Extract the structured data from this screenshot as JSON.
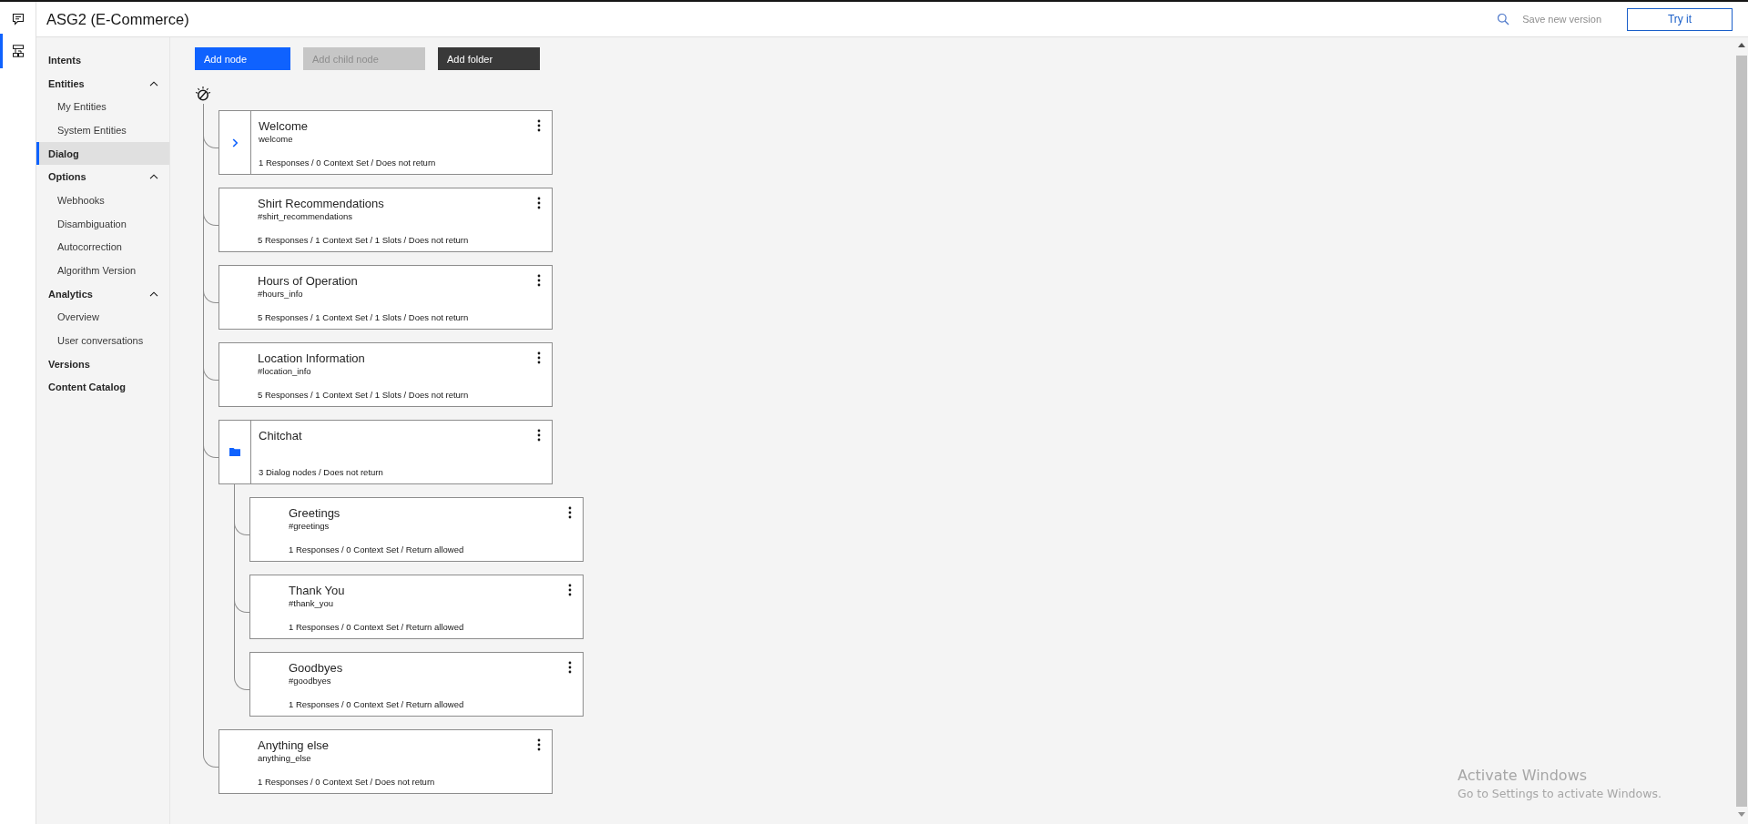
{
  "rail": {
    "items": [
      {
        "kind": "chat",
        "selected": false
      },
      {
        "kind": "tree",
        "selected": true
      }
    ]
  },
  "header": {
    "title": "ASG2 (E-Commerce)",
    "save_label": "Save new version",
    "try_button": "Try it"
  },
  "sidebar": {
    "items": [
      {
        "label": "Intents",
        "selected": false
      },
      {
        "label": "Entities",
        "selected": false,
        "expanded": true,
        "children": [
          {
            "label": "My Entities",
            "selected": false
          },
          {
            "label": "System Entities",
            "selected": false
          }
        ]
      },
      {
        "label": "Dialog",
        "selected": true
      },
      {
        "label": "Options",
        "selected": false,
        "expanded": true,
        "children": [
          {
            "label": "Webhooks",
            "selected": false
          },
          {
            "label": "Disambiguation",
            "selected": false
          },
          {
            "label": "Autocorrection",
            "selected": false
          },
          {
            "label": "Algorithm Version",
            "selected": false
          }
        ]
      },
      {
        "label": "Analytics",
        "selected": false,
        "expanded": true,
        "children": [
          {
            "label": "Overview",
            "selected": false
          },
          {
            "label": "User conversations",
            "selected": false
          }
        ]
      },
      {
        "label": "Versions",
        "selected": false
      },
      {
        "label": "Content Catalog",
        "selected": false
      }
    ]
  },
  "toolbar": {
    "buttons": [
      {
        "label": "Add node",
        "kind": "primary",
        "disabled": false
      },
      {
        "label": "Add child node",
        "kind": "secondary",
        "disabled": true
      },
      {
        "label": "Add folder",
        "kind": "secondary",
        "disabled": false
      }
    ]
  },
  "tree": {
    "nodes": [
      {
        "kind": "parent",
        "title": "Welcome",
        "condition": "welcome",
        "summary": "1 Responses / 0 Context Set / Does not return"
      },
      {
        "kind": "leaf",
        "title": "Shirt Recommendations",
        "condition": "#shirt_recommendations",
        "summary": "5 Responses / 1 Context Set / 1 Slots / Does not return"
      },
      {
        "kind": "leaf",
        "title": "Hours of Operation",
        "condition": "#hours_info",
        "summary": "5 Responses / 1 Context Set / 1 Slots / Does not return"
      },
      {
        "kind": "leaf",
        "title": "Location Information",
        "condition": "#location_info",
        "summary": "5 Responses / 1 Context Set / 1 Slots / Does not return"
      },
      {
        "kind": "folder",
        "title": "Chitchat",
        "summary": "3 Dialog nodes / Does not return",
        "children": [
          {
            "kind": "leaf",
            "title": "Greetings",
            "condition": "#greetings",
            "summary": "1 Responses / 0 Context Set / Return allowed"
          },
          {
            "kind": "leaf",
            "title": "Thank You",
            "condition": "#thank_you",
            "summary": "1 Responses / 0 Context Set / Return allowed"
          },
          {
            "kind": "leaf",
            "title": "Goodbyes",
            "condition": "#goodbyes",
            "summary": "1 Responses / 0 Context Set / Return allowed"
          }
        ]
      },
      {
        "kind": "leaf",
        "title": "Anything else",
        "condition": "anything_else",
        "summary": "1 Responses / 0 Context Set / Does not return"
      }
    ]
  },
  "os_overlay": {
    "title": "Activate Windows",
    "subtitle": "Go to Settings to activate Windows."
  }
}
